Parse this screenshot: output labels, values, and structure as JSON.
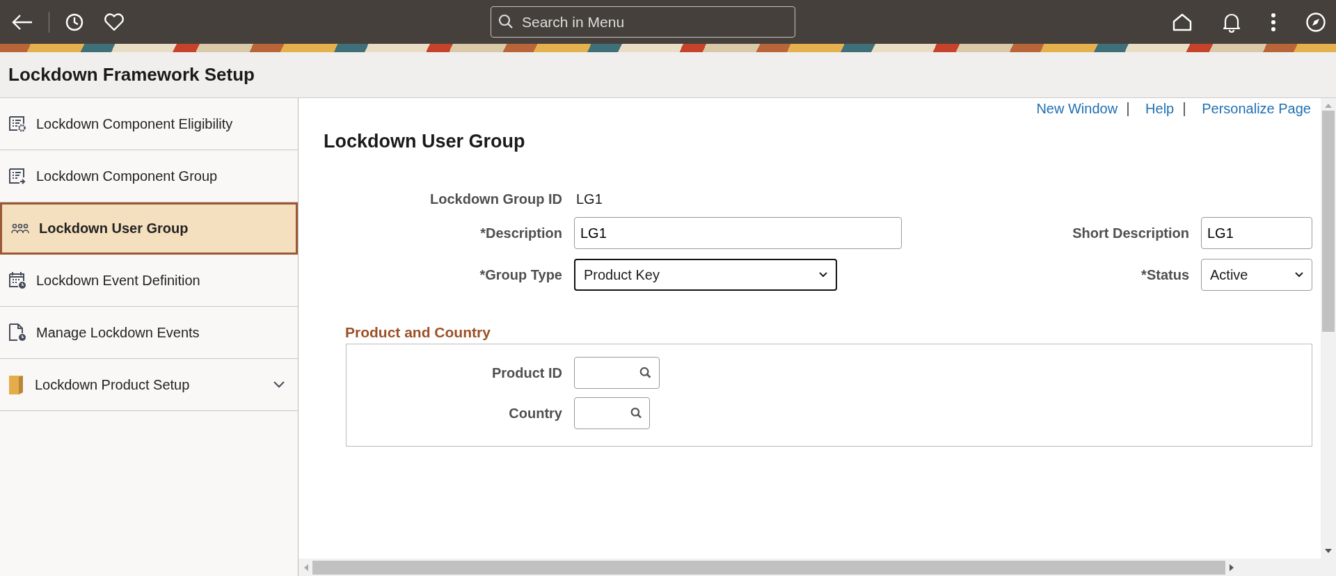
{
  "header": {
    "search": {
      "placeholder": "Search in Menu"
    }
  },
  "page_title": "Lockdown Framework Setup",
  "sidebar": {
    "items": [
      {
        "label": "Lockdown Component Eligibility",
        "selected": false
      },
      {
        "label": "Lockdown Component Group",
        "selected": false
      },
      {
        "label": "Lockdown User Group",
        "selected": true
      },
      {
        "label": "Lockdown Event Definition",
        "selected": false
      },
      {
        "label": "Manage Lockdown Events",
        "selected": false
      },
      {
        "label": "Lockdown Product Setup",
        "selected": false,
        "expanded": false
      }
    ]
  },
  "links": [
    "New Window",
    "Help",
    "Personalize Page"
  ],
  "form": {
    "title": "Lockdown User Group",
    "group_id": {
      "label": "Lockdown Group ID",
      "value": "LG1"
    },
    "description": {
      "label": "*Description",
      "value": "LG1"
    },
    "short_description": {
      "label": "Short Description",
      "value": "LG1"
    },
    "group_type": {
      "label": "*Group Type",
      "value": "Product Key"
    },
    "status": {
      "label": "*Status",
      "value": "Active"
    }
  },
  "section": {
    "title": "Product and Country",
    "fields": [
      {
        "label": "Product ID"
      },
      {
        "label": "Country"
      }
    ]
  }
}
